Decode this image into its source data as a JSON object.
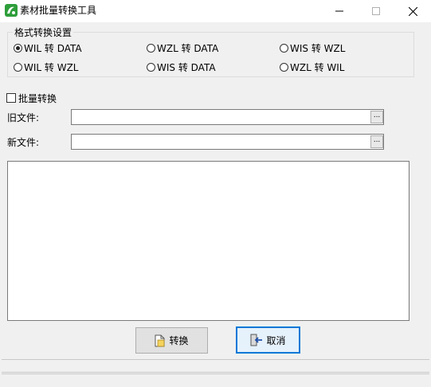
{
  "window": {
    "title": "素材批量转换工具",
    "icon": "app-logo-icon",
    "controls": [
      "minimize-icon",
      "maximize-icon",
      "close-icon"
    ]
  },
  "format_group": {
    "title": "格式转换设置",
    "selected": "WIL 转 DATA",
    "options": [
      {
        "label": "WIL 转 DATA",
        "checked": true
      },
      {
        "label": "WZL 转 DATA",
        "checked": false
      },
      {
        "label": "WIS 转 WZL",
        "checked": false
      },
      {
        "label": "WIL 转 WZL",
        "checked": false
      },
      {
        "label": "WIS 转 DATA",
        "checked": false
      },
      {
        "label": "WZL 转 WIL",
        "checked": false
      }
    ]
  },
  "batch": {
    "label": "批量转换",
    "checked": false
  },
  "old_file": {
    "label": "旧文件:",
    "value": "",
    "browse_label": "..."
  },
  "new_file": {
    "label": "新文件:",
    "value": "",
    "browse_label": "..."
  },
  "log": {
    "text": ""
  },
  "buttons": {
    "convert": "转换",
    "cancel": "取消"
  },
  "colors": {
    "accent": "#0078d7",
    "window_bg": "#f0f0f0",
    "icon_green": "#2e9e3a"
  }
}
